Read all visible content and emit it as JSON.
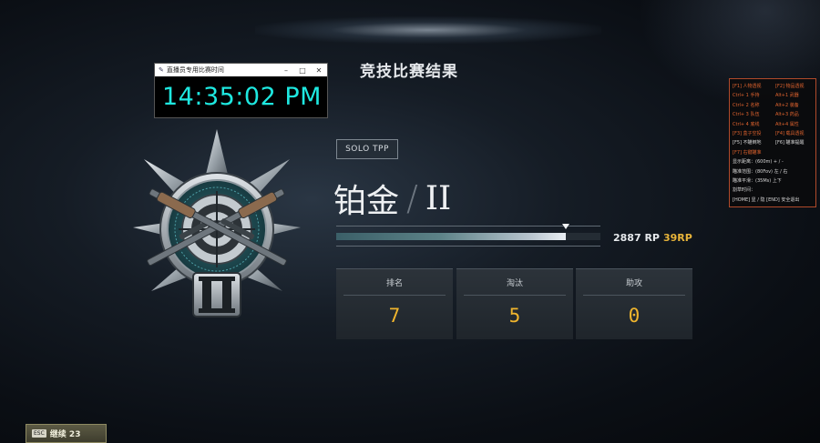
{
  "clock_window": {
    "title": "直播员专用比赛时间",
    "time": "14:35:02 PM",
    "minimize_glyph": "–",
    "maximize_glyph": "□",
    "close_glyph": "✕"
  },
  "page_title": "竞技比赛结果",
  "mode_badge": "SOLO TPP",
  "tier": {
    "name": "铂金",
    "division": "II"
  },
  "rp": {
    "value": "2887 RP",
    "gain": "39RP",
    "progress": 0.87
  },
  "stats": [
    {
      "label": "排名",
      "value": "7"
    },
    {
      "label": "淘汰",
      "value": "5"
    },
    {
      "label": "助攻",
      "value": "0"
    }
  ],
  "overlay": {
    "pairs": [
      {
        "left": "[F1] 人物透视",
        "right": "[F2] 物品透视",
        "color": "orange"
      },
      {
        "left": "Ctrl+ 1 手持",
        "right": "Alt+1 武器",
        "color": "orange"
      },
      {
        "left": "Ctrl+ 2 名称",
        "right": "Alt+2 装备",
        "color": "orange"
      },
      {
        "left": "Ctrl+ 3 队伍",
        "right": "Alt+3 药品",
        "color": "orange"
      },
      {
        "left": "Ctrl+ 4 底线",
        "right": "Alt+4 属性",
        "color": "orange"
      },
      {
        "left": "[F3] 盒子空投",
        "right": "[F4] 载具透视",
        "color": "orange"
      },
      {
        "left": "[F5] 不瞄倒地",
        "right": "[F6] 瞄准提醒",
        "color": "white"
      }
    ],
    "lines": [
      {
        "text": "[F7] 右键瞄准",
        "color": "orange"
      },
      {
        "text": "显示距离：(600m) + / -",
        "color": "white"
      },
      {
        "text": "瞄准范围：(80Fov) 左 / 右",
        "color": "white"
      },
      {
        "text": "瞄准平滑：(35Ms) 上下",
        "color": "white"
      },
      {
        "text": "割草时间：",
        "color": "white"
      },
      {
        "text": "[HOME] 显 / 隐    [END] 安全退出",
        "color": "white"
      }
    ]
  },
  "continue_button": {
    "key": "ESC",
    "label": "继续 23"
  },
  "colors": {
    "accent_gold": "#f0b52d",
    "clock_cyan": "#1ee8e0",
    "overlay_orange": "#e0632e"
  }
}
